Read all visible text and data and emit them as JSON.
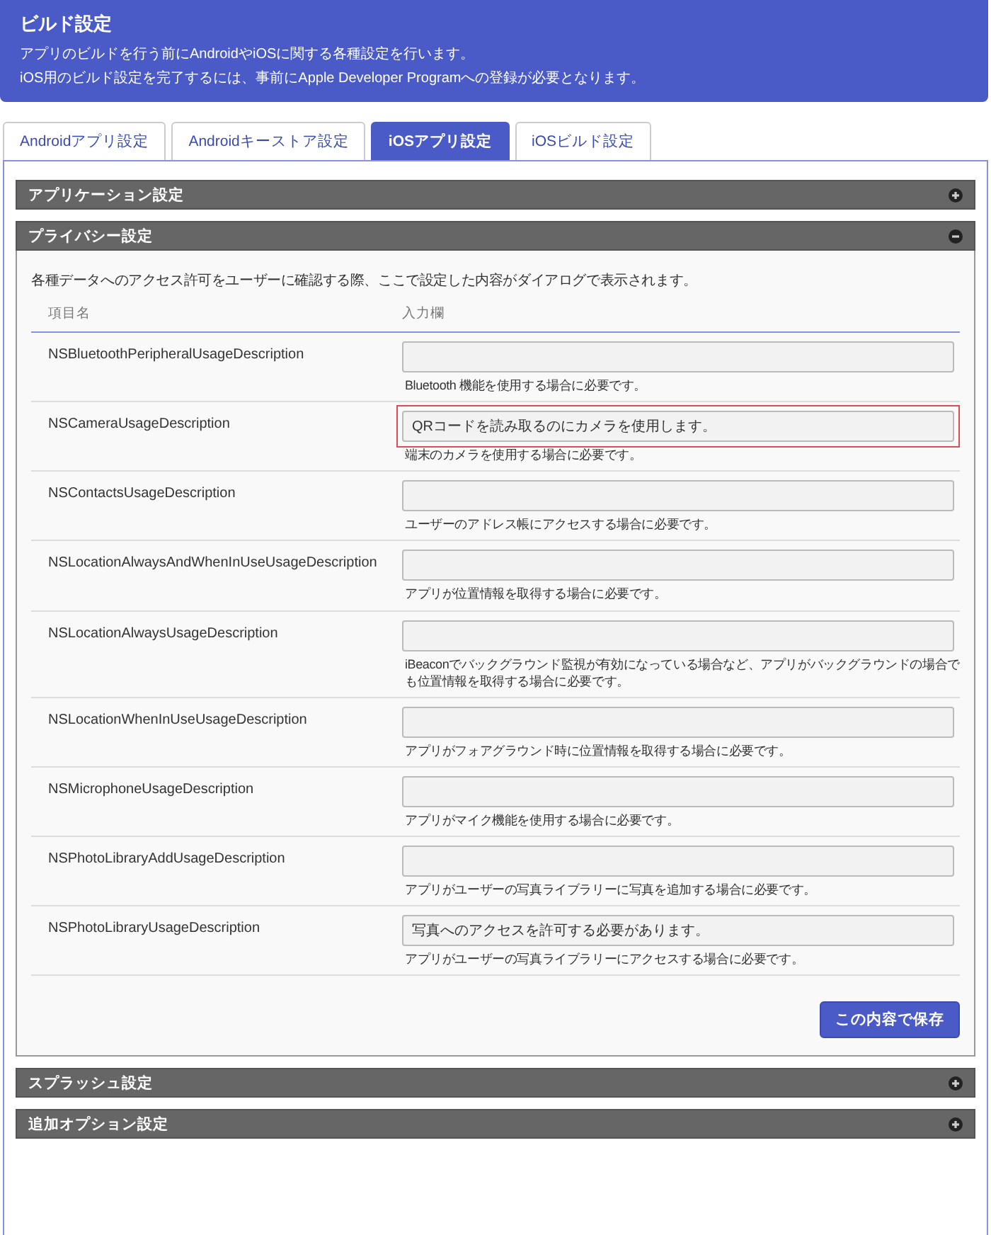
{
  "header": {
    "title": "ビルド設定",
    "lines": [
      "アプリのビルドを行う前にAndroidやiOSに関する各種設定を行います。",
      "iOS用のビルド設定を完了するには、事前にApple Developer Programへの登録が必要となります。"
    ]
  },
  "tabs": [
    {
      "label": "Androidアプリ設定",
      "selected": false
    },
    {
      "label": "Androidキーストア設定",
      "selected": false
    },
    {
      "label": "iOSアプリ設定",
      "selected": true
    },
    {
      "label": "iOSビルド設定",
      "selected": false
    }
  ],
  "sections": [
    {
      "title": "アプリケーション設定",
      "expanded": false
    },
    {
      "title": "プライバシー設定",
      "expanded": true,
      "intro": "各種データへのアクセス許可をユーザーに確認する際、ここで設定した内容がダイアログで表示されます。",
      "columns": [
        "項目名",
        "入力欄"
      ],
      "rows": [
        {
          "name": "NSBluetoothPeripheralUsageDescription",
          "hint": "Bluetooth 機能を使用する場合に必要です。",
          "highlighted": false
        },
        {
          "name": "NSCameraUsageDescription",
          "value": "QRコードを読み取るのにカメラを使用します。",
          "hint": "端末のカメラを使用する場合に必要です。",
          "highlighted": true
        },
        {
          "name": "NSContactsUsageDescription",
          "hint": "ユーザーのアドレス帳にアクセスする場合に必要です。",
          "highlighted": false
        },
        {
          "name": "NSLocationAlwaysAndWhenInUseUsageDescription",
          "hint": "アプリが位置情報を取得する場合に必要です。",
          "highlighted": false
        },
        {
          "name": "NSLocationAlwaysUsageDescription",
          "hint": "iBeaconでバックグラウンド監視が有効になっている場合など、アプリがバックグラウンドの場合でも位置情報を取得する場合に必要です。",
          "highlighted": false
        },
        {
          "name": "NSLocationWhenInUseUsageDescription",
          "hint": "アプリがフォアグラウンド時に位置情報を取得する場合に必要です。",
          "highlighted": false
        },
        {
          "name": "NSMicrophoneUsageDescription",
          "hint": "アプリがマイク機能を使用する場合に必要です。",
          "highlighted": false
        },
        {
          "name": "NSPhotoLibraryAddUsageDescription",
          "hint": "アプリがユーザーの写真ライブラリーに写真を追加する場合に必要です。",
          "highlighted": false
        },
        {
          "name": "NSPhotoLibraryUsageDescription",
          "value": "写真へのアクセスを許可する必要があります。",
          "hint": "アプリがユーザーの写真ライブラリーにアクセスする場合に必要です。",
          "highlighted": false
        }
      ],
      "save_button": "この内容で保存"
    },
    {
      "title": "スプラッシュ設定",
      "expanded": false
    },
    {
      "title": "追加オプション設定",
      "expanded": false
    }
  ]
}
